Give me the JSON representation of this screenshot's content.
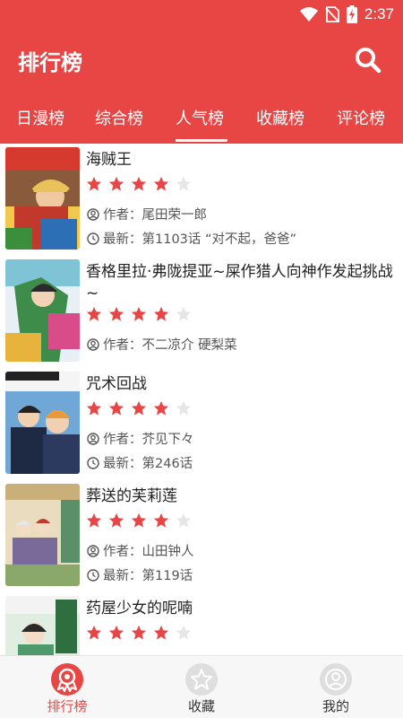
{
  "status": {
    "time": "2:37"
  },
  "header": {
    "title": "排行榜"
  },
  "tabs": [
    {
      "label": "日漫榜"
    },
    {
      "label": "综合榜"
    },
    {
      "label": "人气榜",
      "active": true
    },
    {
      "label": "收藏榜"
    },
    {
      "label": "评论榜"
    }
  ],
  "labels": {
    "author": "作者：",
    "latest": "最新："
  },
  "items": [
    {
      "title": "海贼王",
      "rating": 4,
      "author": "尾田荣一郎",
      "latest": "第1103话 “对不起，爸爸”"
    },
    {
      "title": "香格里拉·弗陇提亚~屎作猎人向神作发起挑战~",
      "rating": 4,
      "author": "不二凉介 硬梨菜",
      "latest": ""
    },
    {
      "title": "咒术回战",
      "rating": 4,
      "author": "芥见下々",
      "latest": "第246话"
    },
    {
      "title": "葬送的芙莉莲",
      "rating": 4,
      "author": "山田钟人",
      "latest": "第119话"
    },
    {
      "title": "药屋少女的呢喃",
      "rating": 4,
      "author": "",
      "latest": ""
    }
  ],
  "nav": [
    {
      "label": "排行榜",
      "active": true
    },
    {
      "label": "收藏"
    },
    {
      "label": "我的"
    }
  ],
  "colors": {
    "primary": "#e84545",
    "star_on": "#e84545",
    "star_off": "#e6e6e6",
    "inactive": "#333333"
  }
}
